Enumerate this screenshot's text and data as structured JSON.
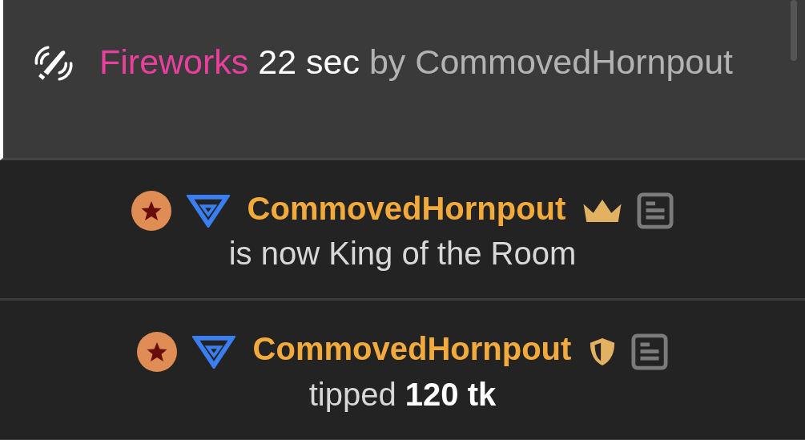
{
  "notice": {
    "effect": "Fireworks",
    "duration": "22 sec",
    "by": "by",
    "user": "CommovedHornpout"
  },
  "messages": [
    {
      "kind": "king",
      "user": "CommovedHornpout",
      "text": "is now King of the Room"
    },
    {
      "kind": "tip",
      "user": "CommovedHornpout",
      "text": "tipped **120 tk**"
    }
  ]
}
